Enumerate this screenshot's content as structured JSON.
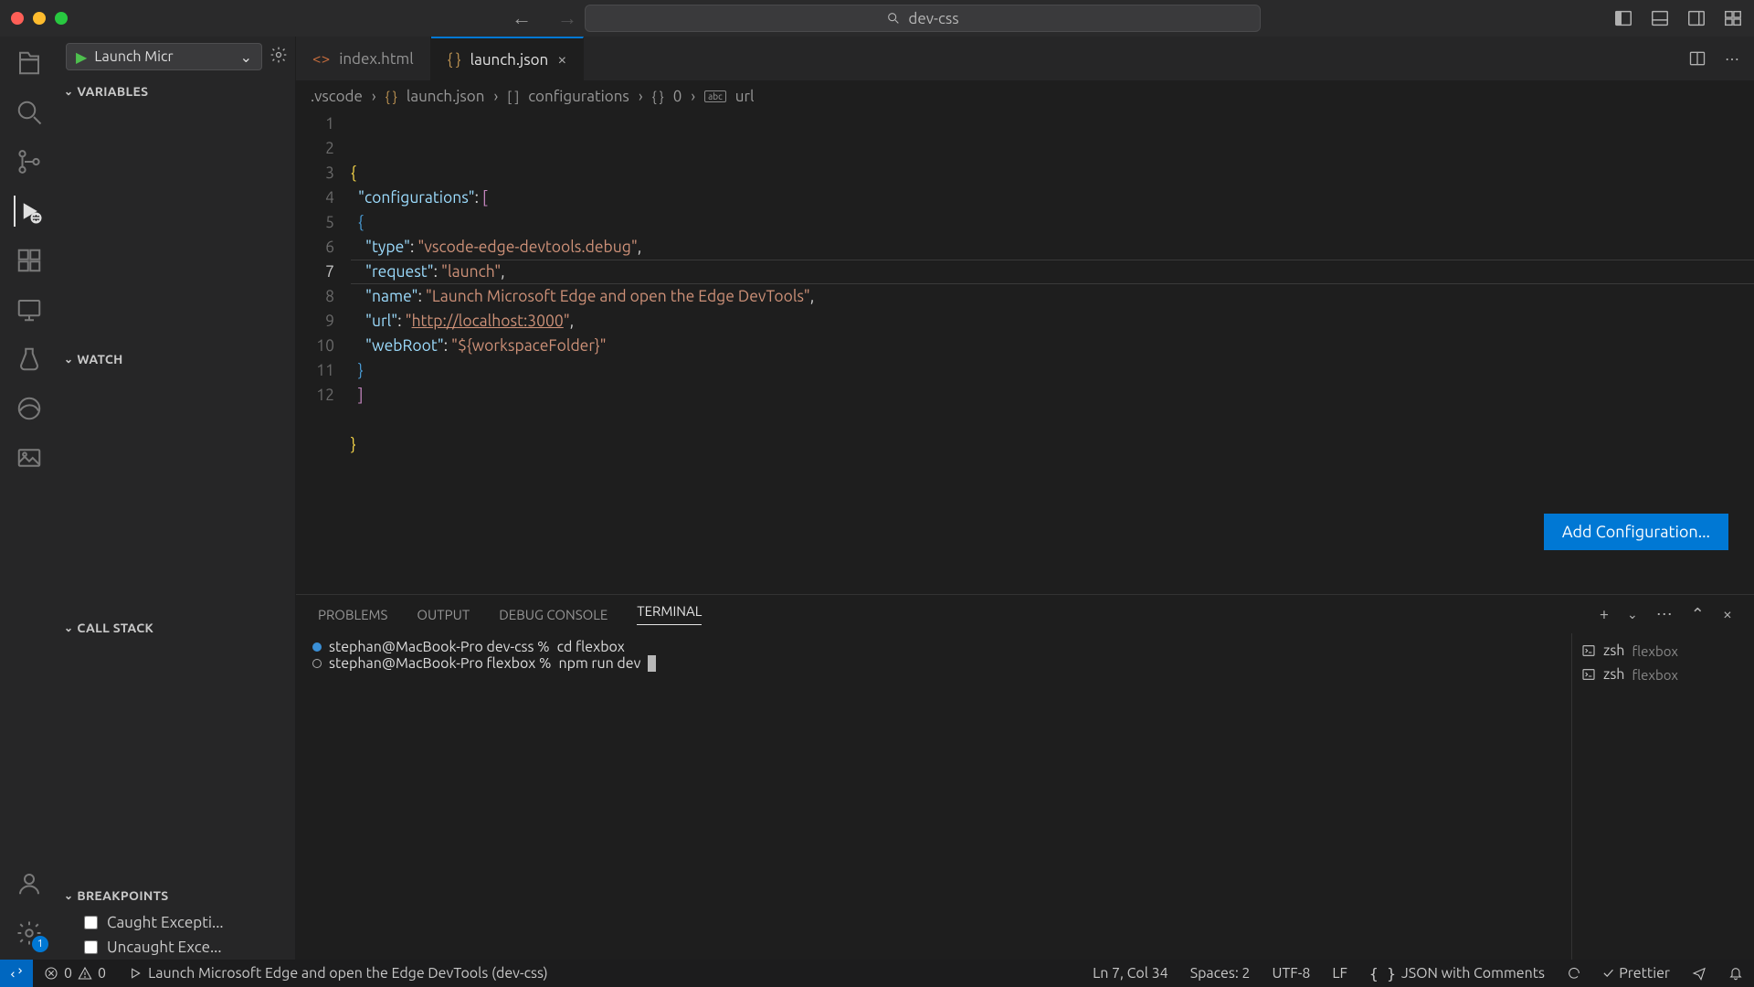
{
  "titlebar": {
    "search_text": "dev-css"
  },
  "run_debug": {
    "config_name": "Launch Micr",
    "variables_header": "VARIABLES",
    "watch_header": "WATCH",
    "callstack_header": "CALL STACK",
    "breakpoints_header": "BREAKPOINTS",
    "breakpoints": {
      "caught": "Caught Excepti...",
      "uncaught": "Uncaught Exce..."
    }
  },
  "tabs": {
    "index": "index.html",
    "launch": "launch.json"
  },
  "breadcrumb": {
    "p1": ".vscode",
    "p2": "launch.json",
    "p3": "configurations",
    "p4": "0",
    "p5": "url",
    "i2": "{ }",
    "i3": "[ ]",
    "i4": "{ }",
    "i5_svg": true
  },
  "editor": {
    "lines": [
      "1",
      "2",
      "3",
      "4",
      "5",
      "6",
      "7",
      "8",
      "9",
      "10",
      "11",
      "12"
    ],
    "current_line": 7,
    "content": {
      "configurations_key": "\"configurations\"",
      "type_key": "\"type\"",
      "type_val": "\"vscode-edge-devtools.debug\"",
      "request_key": "\"request\"",
      "request_val": "\"launch\"",
      "name_key": "\"name\"",
      "name_val": "\"Launch Microsoft Edge and open the Edge DevTools\"",
      "url_key": "\"url\"",
      "url_q": "\"",
      "url_val": "http://localhost:3000",
      "webroot_key": "\"webRoot\"",
      "webroot_val": "\"${workspaceFolder}\""
    },
    "add_cfg_button": "Add Configuration..."
  },
  "panel": {
    "tabs": {
      "problems": "PROBLEMS",
      "output": "OUTPUT",
      "debug": "DEBUG CONSOLE",
      "terminal": "TERMINAL"
    },
    "terminal": {
      "line1_prompt": "stephan@MacBook-Pro dev-css %",
      "line1_cmd": "cd flexbox",
      "line2_prompt": "stephan@MacBook-Pro flexbox %",
      "line2_cmd": "npm run dev"
    },
    "terminals": [
      {
        "shell": "zsh",
        "name": "flexbox"
      },
      {
        "shell": "zsh",
        "name": "flexbox"
      }
    ]
  },
  "status": {
    "errors": "0",
    "warnings": "0",
    "launch_label": "Launch Microsoft Edge and open the Edge DevTools (dev-css)",
    "ln_col": "Ln 7, Col 34",
    "spaces": "Spaces: 2",
    "encoding": "UTF-8",
    "eol": "LF",
    "lang": "JSON with Comments",
    "prettier": "Prettier"
  },
  "activity_badge": "1"
}
